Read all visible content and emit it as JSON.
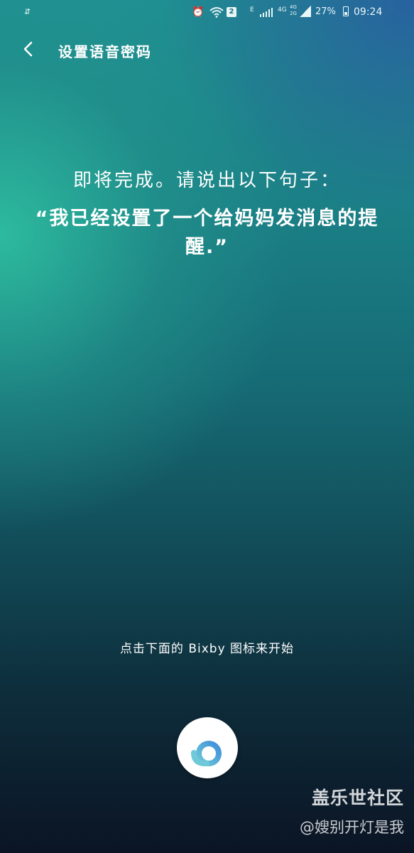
{
  "status_bar": {
    "data_indicator": "⇵",
    "sim_slot": "2",
    "network_e": "E",
    "network_4g": "4G",
    "dual_network": "4G\n2G",
    "battery_percent": "27%",
    "battery_level_fraction": 0.27,
    "time": "09:24",
    "icons": [
      "alarm-icon",
      "wifi-icon",
      "signal-icon",
      "battery-icon"
    ]
  },
  "header": {
    "title": "设置语音密码"
  },
  "prompt": {
    "instruction": "即将完成。请说出以下句子：",
    "phrase": "“我已经设置了一个给妈妈发消息的提醒.”"
  },
  "footer": {
    "hint": "点击下面的 Bixby 图标来开始",
    "bixby_icon": "bixby-icon",
    "bixby_colors": [
      "#6fc9d8",
      "#3f8fd9"
    ]
  },
  "watermark": {
    "title": "盖乐世社区",
    "user": "@嫂别开灯是我"
  }
}
